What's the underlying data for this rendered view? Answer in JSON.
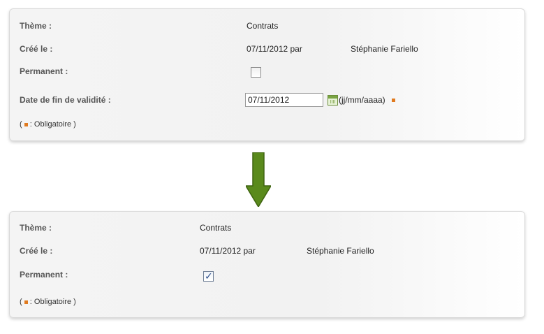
{
  "form_before": {
    "theme_label": "Thème :",
    "theme_value": "Contrats",
    "created_label": "Créé le :",
    "created_date": "07/11/2012 par",
    "created_by": "Stéphanie Fariello",
    "permanent_label": "Permanent :",
    "permanent_checked": false,
    "end_date_label": "Date de fin de validité :",
    "end_date_value": "07/11/2012",
    "date_format_hint": "(jj/mm/aaaa)",
    "note_open": "(",
    "note_text": ": Obligatoire )"
  },
  "form_after": {
    "theme_label": "Thème :",
    "theme_value": "Contrats",
    "created_label": "Créé le :",
    "created_date": "07/11/2012 par",
    "created_by": "Stéphanie Fariello",
    "permanent_label": "Permanent :",
    "permanent_checked": true,
    "note_open": "(",
    "note_text": ": Obligatoire )"
  },
  "icons": {
    "calendar": "calendar-icon",
    "arrow": "arrow-down-icon",
    "check": "checkmark-icon"
  },
  "colors": {
    "arrow_fill": "#5a8a1c",
    "arrow_stroke": "#3f6410",
    "required": "#e07a1f",
    "check": "#2c4e8a"
  }
}
